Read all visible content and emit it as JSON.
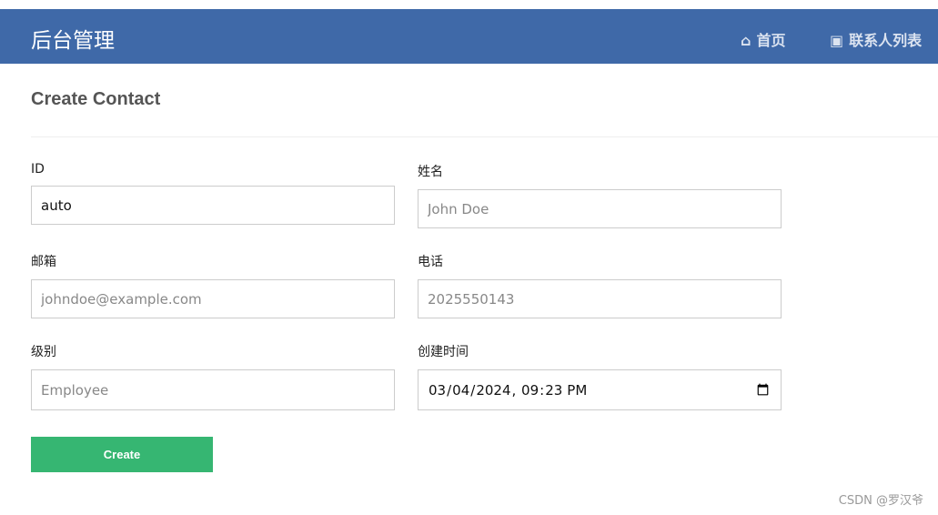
{
  "nav": {
    "brand": "后台管理",
    "links": [
      {
        "icon": "home-icon",
        "label": "首页"
      },
      {
        "icon": "contact-book-icon",
        "label": "联系人列表"
      }
    ]
  },
  "page": {
    "title": "Create Contact"
  },
  "form": {
    "id": {
      "label": "ID",
      "value": "auto"
    },
    "name": {
      "label": "姓名",
      "placeholder": "John Doe"
    },
    "email": {
      "label": "邮箱",
      "placeholder": "johndoe@example.com"
    },
    "phone": {
      "label": "电话",
      "placeholder": "2025550143"
    },
    "level": {
      "label": "级别",
      "placeholder": "Employee"
    },
    "created": {
      "label": "创建时间",
      "value": "2024-03-04T21:23"
    },
    "submit": "Create"
  },
  "watermark": "CSDN @罗汉爷",
  "colors": {
    "navbar": "#3f69a8",
    "button": "#36b672"
  }
}
